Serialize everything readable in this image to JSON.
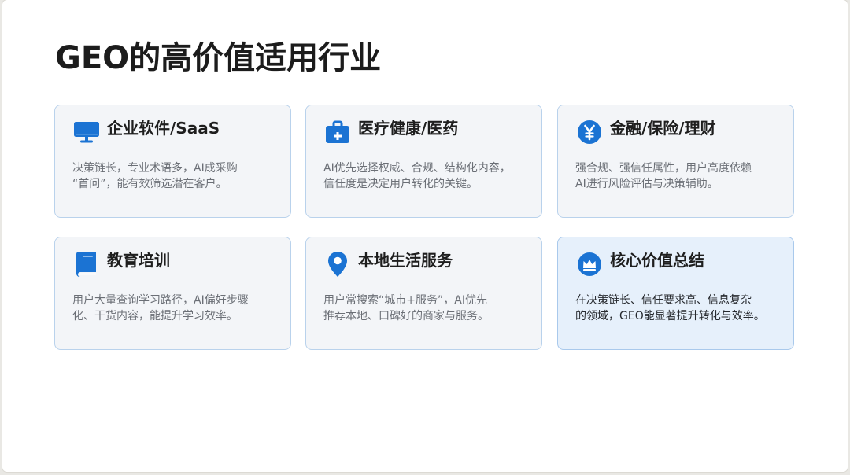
{
  "slide": {
    "title": "GEO的高价值适用行业",
    "cards": [
      {
        "title": "企业软件/SaaS",
        "icon": "monitor-icon",
        "description": "决策链长，专业术语多，AI成采购\n“首问”，能有效筛选潜在客户。"
      },
      {
        "title": "医疗健康/医药",
        "icon": "medical-kit-icon",
        "description": "AI优先选择权威、合规、结构化内容，\n信任度是决定用户转化的关键。"
      },
      {
        "title": "金融/保险/理财",
        "icon": "yen-coin-icon",
        "description": "强合规、强信任属性，用户高度依赖\nAI进行风险评估与决策辅助。"
      },
      {
        "title": "教育培训",
        "icon": "book-icon",
        "description": "用户大量查询学习路径，AI偏好步骤\n化、干货内容，能提升学习效率。"
      },
      {
        "title": "本地生活服务",
        "icon": "location-pin-icon",
        "description": "用户常搜索“城市+服务”，AI优先\n推荐本地、口碑好的商家与服务。"
      },
      {
        "title": "核心价值总结",
        "icon": "crown-icon",
        "description": "在决策链长、信任要求高、信息复杂\n的领域，GEO能显著提升转化与效率。"
      }
    ]
  },
  "colors": {
    "accent": "#1b73d3",
    "card_background": "#f3f5f8",
    "card_border": "#b9d2ec",
    "highlight_background": "#e6f0fb"
  }
}
